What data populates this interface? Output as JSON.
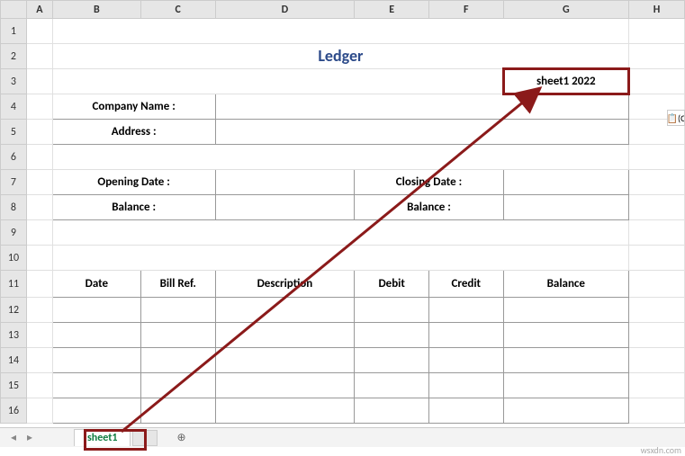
{
  "columns": [
    "A",
    "B",
    "C",
    "D",
    "E",
    "F",
    "G",
    "H"
  ],
  "rows": [
    "1",
    "2",
    "3",
    "4",
    "5",
    "6",
    "7",
    "8",
    "9",
    "10",
    "11",
    "12",
    "13",
    "14",
    "15",
    "16"
  ],
  "title": "Ledger",
  "date_display": "sheet1 2022",
  "labels": {
    "company_name": "Company Name :",
    "address": "Address :",
    "opening_date": "Opening Date :",
    "closing_date": "Closing Date :",
    "balance1": "Balance :",
    "balance2": "Balance :"
  },
  "table_headers": {
    "date": "Date",
    "bill_ref": "Bill Ref.",
    "description": "Description",
    "debit": "Debit",
    "credit": "Credit",
    "balance": "Balance"
  },
  "paste_label": "(C",
  "tabs": {
    "active": "sheet1"
  },
  "watermark": "wsxdn.com",
  "chart_data": {
    "type": "table",
    "title": "Ledger",
    "columns": [
      "Date",
      "Bill Ref.",
      "Description",
      "Debit",
      "Credit",
      "Balance"
    ],
    "rows": [],
    "meta_fields": [
      "Company Name",
      "Address",
      "Opening Date",
      "Closing Date",
      "Balance",
      "Balance"
    ],
    "display_period": "sheet1 2022"
  }
}
